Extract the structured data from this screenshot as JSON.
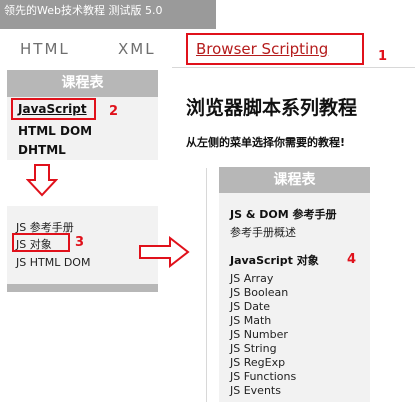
{
  "top_banner": {
    "text": "领先的Web技术教程 测试版 5.0"
  },
  "tabs": [
    {
      "label": "HTML"
    },
    {
      "label": "XML"
    }
  ],
  "active_tab": {
    "label": "Browser Scripting"
  },
  "callouts": [
    "1",
    "2",
    "3",
    "4"
  ],
  "left_menu": {
    "heading": "课程表",
    "items": [
      {
        "label": "JavaScript"
      },
      {
        "label": "HTML DOM"
      },
      {
        "label": "DHTML"
      }
    ]
  },
  "left_sub_menu": {
    "items": [
      {
        "label": "JS 参考手册"
      },
      {
        "label": "JS 对象"
      },
      {
        "label": "JS HTML DOM"
      }
    ]
  },
  "main": {
    "title": "浏览器脚本系列教程",
    "subtitle": "从左侧的菜单选择你需要的教程!"
  },
  "right_menu": {
    "heading": "课程表",
    "section1_title": "JS & DOM 参考手册",
    "section1_item": "参考手册概述",
    "section2_title": "JavaScript 对象",
    "items": [
      {
        "label": "JS Array"
      },
      {
        "label": "JS Boolean"
      },
      {
        "label": "JS Date"
      },
      {
        "label": "JS Math"
      },
      {
        "label": "JS Number"
      },
      {
        "label": "JS String"
      },
      {
        "label": "JS RegExp"
      },
      {
        "label": "JS Functions"
      },
      {
        "label": "JS Events"
      }
    ]
  },
  "colors": {
    "accent_red": "#e0111b",
    "tab_red": "#b51c1c",
    "menu_gray": "#b7b7b7"
  }
}
